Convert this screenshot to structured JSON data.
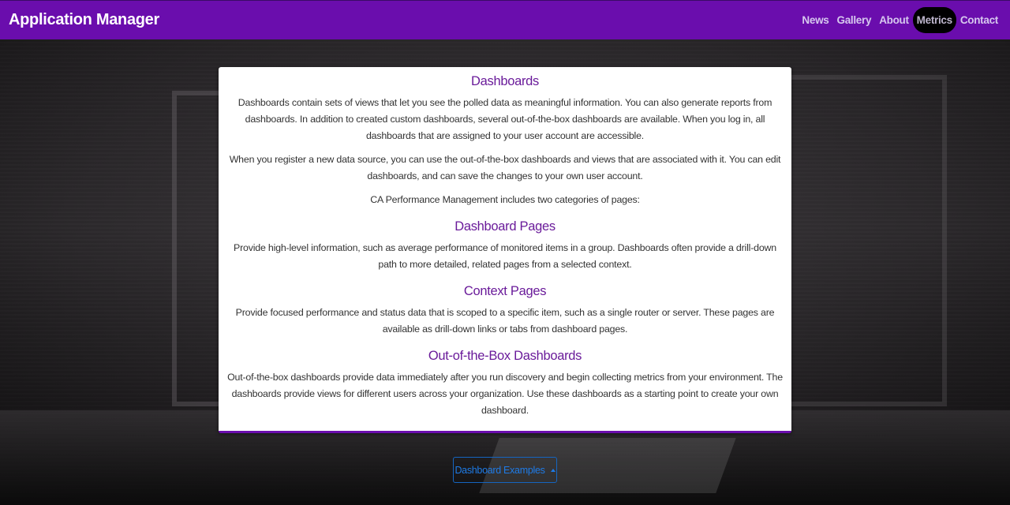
{
  "app": {
    "title": "Application Manager"
  },
  "nav": {
    "items": [
      {
        "label": "News"
      },
      {
        "label": "Gallery"
      },
      {
        "label": "About"
      },
      {
        "label": "Metrics"
      },
      {
        "label": "Contact"
      }
    ],
    "active": "Metrics"
  },
  "content": {
    "title": "Dashboards",
    "intro_1": "Dashboards contain sets of views that let you see the polled data as meaningful information. You can also generate reports from dashboards. In addition to created custom dashboards, several out-of-the-box dashboards are available. When you log in, all dashboards that are assigned to your user account are accessible.",
    "intro_2": "When you register a new data source, you can use the out-of-the-box dashboards and views that are associated with it. You can edit dashboards, and can save the changes to your own user account.",
    "intro_3": "CA Performance Management includes two categories of pages:",
    "sections": [
      {
        "heading": "Dashboard Pages",
        "text": "Provide high-level information, such as average performance of monitored items in a group. Dashboards often provide a drill-down path to more detailed, related pages from a selected context."
      },
      {
        "heading": "Context Pages",
        "text": "Provide focused performance and status data that is scoped to a specific item, such as a single router or server. These pages are available as drill-down links or tabs from dashboard pages."
      },
      {
        "heading": "Out-of-the-Box Dashboards",
        "text": "Out-of-the-box dashboards provide data immediately after you run discovery and begin collecting metrics from your environment. The dashboards provide views for different users across your organization. Use these dashboards as a starting point to create your own dashboard."
      }
    ]
  },
  "dropdown": {
    "label": "Dashboard Examples",
    "icon": "caret-up-icon"
  },
  "colors": {
    "navbar": "#6a0dad",
    "heading": "#6a1b9a",
    "button": "#1e7be6"
  }
}
